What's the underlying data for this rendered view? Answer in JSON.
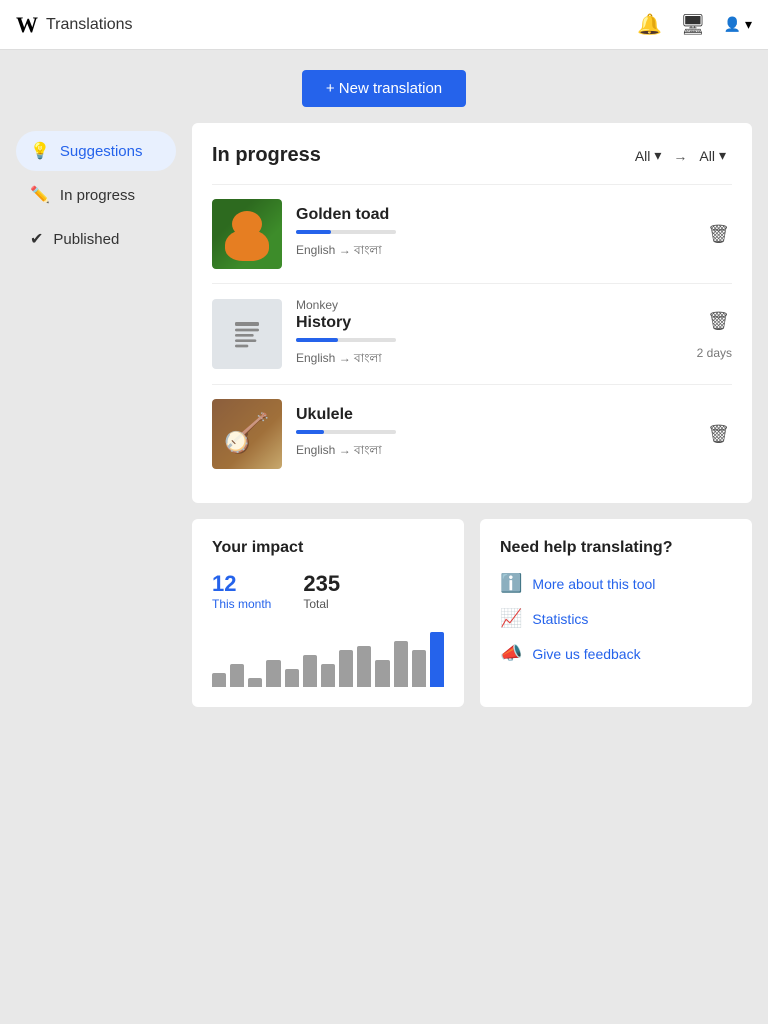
{
  "topnav": {
    "logo": "W",
    "title": "Translations",
    "icons": {
      "bell": "🔔",
      "monitor": "🖥",
      "user": "👤"
    },
    "user_arrow": "▾"
  },
  "new_translation_btn": "+ New translation",
  "sidebar": {
    "items": [
      {
        "id": "suggestions",
        "label": "Suggestions",
        "icon": "💡",
        "active": true
      },
      {
        "id": "in-progress",
        "label": "In progress",
        "icon": "✏️",
        "active": false
      },
      {
        "id": "published",
        "label": "Published",
        "icon": "✔",
        "active": false
      }
    ]
  },
  "in_progress": {
    "title": "In progress",
    "filter_left": "All",
    "arrow": "→",
    "filter_right": "All",
    "items": [
      {
        "id": "golden-toad",
        "title": "Golden toad",
        "subtitle": "",
        "lang_from": "English",
        "lang_to": "বাংলা",
        "progress_pct": 35,
        "days_label": "",
        "type": "toad"
      },
      {
        "id": "monkey-history",
        "title": "History",
        "subtitle": "Monkey",
        "lang_from": "English",
        "lang_to": "বাংলা",
        "progress_pct": 42,
        "days_label": "2 days",
        "type": "doc"
      },
      {
        "id": "ukulele",
        "title": "Ukulele",
        "subtitle": "",
        "lang_from": "English",
        "lang_to": "বাংলা",
        "progress_pct": 28,
        "days_label": "",
        "type": "ukulele"
      }
    ]
  },
  "impact": {
    "title": "Your impact",
    "this_month_num": "12",
    "this_month_label": "This month",
    "total_num": "235",
    "total_label": "Total",
    "chart_bars": [
      3,
      5,
      2,
      6,
      4,
      7,
      5,
      8,
      9,
      6,
      10,
      8,
      12
    ]
  },
  "help": {
    "title": "Need help translating?",
    "links": [
      {
        "id": "more-about",
        "icon": "ℹ️",
        "label": "More about this tool"
      },
      {
        "id": "statistics",
        "icon": "📈",
        "label": "Statistics"
      },
      {
        "id": "feedback",
        "icon": "📣",
        "label": "Give us feedback"
      }
    ]
  }
}
